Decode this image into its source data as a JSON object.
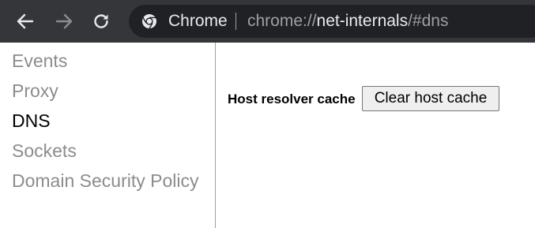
{
  "browser": {
    "back_icon": "arrow-left-icon",
    "forward_icon": "arrow-right-icon",
    "reload_icon": "reload-icon",
    "site_icon": "chrome-logo-icon",
    "site_name": "Chrome",
    "url": {
      "scheme": "chrome://",
      "host": "net-internals",
      "path": "/#dns"
    },
    "colors": {
      "toolbar": "#35363a",
      "omnibox": "#202124",
      "icon_active": "#e8eaed",
      "icon_disabled": "#8a8b8e"
    }
  },
  "sidebar": {
    "items": [
      {
        "label": "Events",
        "selected": false
      },
      {
        "label": "Proxy",
        "selected": false
      },
      {
        "label": "DNS",
        "selected": true
      },
      {
        "label": "Sockets",
        "selected": false
      },
      {
        "label": "Domain Security Policy",
        "selected": false
      }
    ]
  },
  "main": {
    "resolver_label": "Host resolver cache",
    "clear_button_label": "Clear host cache"
  }
}
